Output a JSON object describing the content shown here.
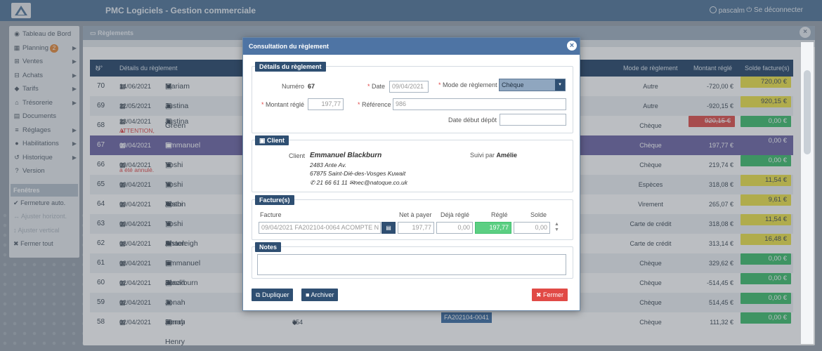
{
  "app": {
    "title": "PMC Logiciels - Gestion commerciale",
    "user": "pascalm",
    "logout": "Se déconnecter"
  },
  "sidebar": {
    "items": [
      {
        "label": "Tableau de Bord",
        "icon": "dashboard-icon",
        "arrow": false
      },
      {
        "label": "Planning",
        "icon": "calendar-icon",
        "badge": "2",
        "arrow": true
      },
      {
        "label": "Ventes",
        "icon": "plus-icon",
        "arrow": true
      },
      {
        "label": "Achats",
        "icon": "minus-icon",
        "arrow": true
      },
      {
        "label": "Tarifs",
        "icon": "tag-icon",
        "arrow": true
      },
      {
        "label": "Trésorerie",
        "icon": "bank-icon",
        "arrow": true
      },
      {
        "label": "Documents",
        "icon": "document-icon",
        "arrow": false
      },
      {
        "label": "Réglages",
        "icon": "sliders-icon",
        "arrow": true
      },
      {
        "label": "Habilitations",
        "icon": "lock-icon",
        "arrow": true
      },
      {
        "label": "Historique",
        "icon": "history-icon",
        "arrow": true
      },
      {
        "label": "Version",
        "icon": "question-icon",
        "arrow": false
      }
    ],
    "windows_header": "Fenêtres",
    "windows": [
      {
        "label": "Fermeture auto.",
        "icon": "✔",
        "disabled": false
      },
      {
        "label": "Ajuster horizont.",
        "icon": "↔",
        "disabled": true
      },
      {
        "label": "Ajuster vertical",
        "icon": "↕",
        "disabled": true
      },
      {
        "label": "Fermer tout",
        "icon": "✖",
        "disabled": false
      }
    ]
  },
  "panel": {
    "title": "Règlements",
    "columns": {
      "num": "N°",
      "details": "Détails du règlement",
      "mode": "Mode de règlement",
      "montant": "Montant réglé",
      "solde": "Solde facture(s)"
    },
    "rows": [
      {
        "num": "70",
        "date": "14/06/2021",
        "name": "Mariam Moore",
        "mode": "Autre",
        "montant": "-720,00 €",
        "solde": "720,00 €",
        "sc": "y"
      },
      {
        "num": "69",
        "date": "22/05/2021",
        "name": "Justina Green",
        "mode": "Autre",
        "montant": "-920,15 €",
        "solde": "920,15 €",
        "sc": "y"
      },
      {
        "num": "68",
        "date": "23/04/2021",
        "name": "Justina Green",
        "warn": "ATTENTION, ce règlement a été annulé.",
        "mode": "Chèque",
        "montant": "920,15 €",
        "solde": "0,00 €",
        "sc": "g"
      },
      {
        "num": "67",
        "date": "09/04/2021",
        "name": "Emmanuel Blackburn",
        "mode": "Chèque",
        "montant": "197,77 €",
        "solde": "0,00 €",
        "sc": "sel"
      },
      {
        "num": "66",
        "date": "09/04/2021",
        "name": "Yoshi Alston",
        "mode": "Chèque",
        "montant": "219,74 €",
        "solde": "0,00 €",
        "sc": "g"
      },
      {
        "num": "65",
        "date": "09/04/2021",
        "name": "Yoshi Alston",
        "mode": "Espèces",
        "montant": "318,08 €",
        "solde": "11,54 €",
        "sc": "y"
      },
      {
        "num": "64",
        "date": "09/04/2021",
        "name": "Yoshi Alston",
        "mode": "Virement",
        "montant": "265,07 €",
        "solde": "9,61 €",
        "sc": "y"
      },
      {
        "num": "63",
        "date": "09/04/2021",
        "name": "Yoshi Alston",
        "mode": "Carte de crédit",
        "montant": "318,08 €",
        "solde": "11,54 €",
        "sc": "y"
      },
      {
        "num": "62",
        "date": "08/04/2021",
        "name": "Shaeleigh Frazier",
        "mode": "Carte de crédit",
        "montant": "313,14 €",
        "solde": "16,48 €",
        "sc": "y"
      },
      {
        "num": "61",
        "date": "08/04/2021",
        "name": "Emmanuel Blackburn",
        "mode": "Chèque",
        "montant": "329,62 €",
        "solde": "0,00 €",
        "sc": "g"
      },
      {
        "num": "60",
        "date": "02/04/2021",
        "name": "Jonah Henry",
        "mode": "Chèque",
        "montant": "-514,45 €",
        "solde": "0,00 €",
        "sc": "g"
      },
      {
        "num": "59",
        "date": "02/04/2021",
        "name": "Jonah Henry",
        "mode": "Chèque",
        "montant": "514,45 €",
        "solde": "0,00 €",
        "sc": "g"
      },
      {
        "num": "58",
        "date": "02/04/2021",
        "name": "Jonah Henry",
        "ref": "654",
        "invoice": "FA202104-0041",
        "mode": "Chèque",
        "montant": "111,32 €",
        "solde": "0,00 €",
        "sc": "g"
      }
    ]
  },
  "modal": {
    "title": "Consultation du règlement",
    "details": {
      "legend": "Détails du règlement",
      "numero_label": "Numéro",
      "numero": "67",
      "date_label": "Date",
      "date": "09/04/2021",
      "mode_label": "Mode de règlement",
      "mode": "Chèque",
      "montant_label": "Montant réglé",
      "montant": "197,77",
      "reference_label": "Référence",
      "reference": "986",
      "depot_label": "Date début dépôt",
      "depot": ""
    },
    "client": {
      "legend": "Client",
      "label": "Client",
      "name": "Emmanuel Blackburn",
      "addr1": "2483 Ante Av.",
      "addr2": "67875  Saint-Dié-des-Vosges  Kuwait",
      "phone": "21 66 61 11",
      "email": "nec@natoque.co.uk",
      "suivi_label": "Suivi par",
      "suivi": "Amélie"
    },
    "factures": {
      "legend": "Facture(s)",
      "col_facture": "Facture",
      "col_net": "Net à payer",
      "col_deja": "Déjà réglé",
      "col_regle": "Réglé",
      "col_solde": "Solde",
      "facture": "09/04/2021 FA202104-0064 ACOMPTE N",
      "net": "197,77",
      "deja": "0,00",
      "regle": "197,77",
      "solde": "0,00"
    },
    "notes": {
      "legend": "Notes",
      "value": ""
    },
    "buttons": {
      "dupliquer": "Dupliquer",
      "archiver": "Archiver",
      "fermer": "Fermer"
    }
  }
}
